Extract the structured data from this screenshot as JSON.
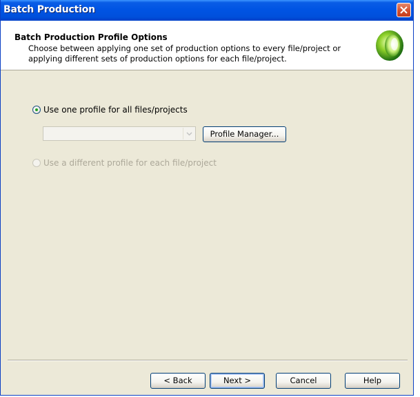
{
  "window": {
    "title": "Batch Production"
  },
  "header": {
    "title": "Batch Production Profile Options",
    "description": "Choose between applying one set of production options to every file/project or applying different sets of production options for each file/project."
  },
  "options": {
    "one_profile_label": "Use one profile for all files/projects",
    "one_profile_selected": true,
    "different_profile_label": "Use a different profile for each file/project",
    "different_profile_enabled": false,
    "profile_select_value": "",
    "profile_manager_label": "Profile Manager..."
  },
  "footer": {
    "back_label": "< Back",
    "next_label": "Next >",
    "cancel_label": "Cancel",
    "help_label": "Help"
  },
  "colors": {
    "titlebar": "#0054e3",
    "dialog_bg": "#ece9d8",
    "radio_check": "#21a121",
    "close_button": "#d4502f"
  }
}
